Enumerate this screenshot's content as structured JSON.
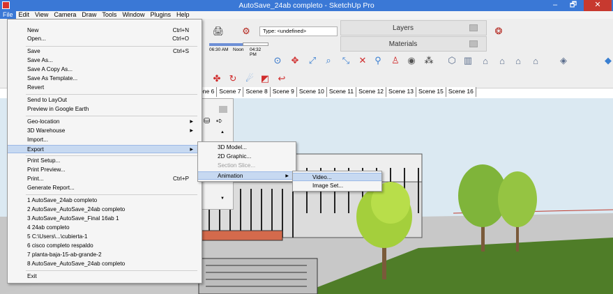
{
  "window": {
    "title": "AutoSave_24ab completo - SketchUp Pro",
    "minimize": "–",
    "maximize": "🗗",
    "close": "✕"
  },
  "menubar": [
    "File",
    "Edit",
    "View",
    "Camera",
    "Draw",
    "Tools",
    "Window",
    "Plugins",
    "Help"
  ],
  "toolbar": {
    "type_field": "Type: <undefined>",
    "time_left": "06:30 AM",
    "time_mid": "Noon",
    "time_right": "04:32 PM"
  },
  "trays": {
    "layers": "Layers",
    "materials": "Materials"
  },
  "scene_tabs": [
    "ene 6",
    "Scene 7",
    "Scene 8",
    "Scene 9",
    "Scene 10",
    "Scene 11",
    "Scene 12",
    "Scene 13",
    "Scene 15",
    "Scene 16"
  ],
  "file_menu": {
    "new": {
      "label": "New",
      "shortcut": "Ctrl+N"
    },
    "open": {
      "label": "Open...",
      "shortcut": "Ctrl+O"
    },
    "save": {
      "label": "Save",
      "shortcut": "Ctrl+S"
    },
    "save_as": {
      "label": "Save As..."
    },
    "save_copy": {
      "label": "Save A Copy As..."
    },
    "save_template": {
      "label": "Save As Template..."
    },
    "revert": {
      "label": "Revert"
    },
    "send_layout": {
      "label": "Send to LayOut"
    },
    "preview_ge": {
      "label": "Preview in Google Earth"
    },
    "geo": {
      "label": "Geo-location"
    },
    "warehouse": {
      "label": "3D Warehouse"
    },
    "import": {
      "label": "Import..."
    },
    "export": {
      "label": "Export"
    },
    "print_setup": {
      "label": "Print Setup..."
    },
    "print_preview": {
      "label": "Print Preview..."
    },
    "print": {
      "label": "Print...",
      "shortcut": "Ctrl+P"
    },
    "report": {
      "label": "Generate Report..."
    },
    "recent": [
      "1 AutoSave_24ab completo",
      "2 AutoSave_AutoSave_24ab completo",
      "3 AutoSave_AutoSave_Final 16ab 1",
      "4 24ab completo",
      "5 C:\\Users\\...\\cubierta-1",
      "6 cisco completo respaldo",
      "7 planta-baja-15-ab-grande-2",
      "8 AutoSave_AutoSave_24ab completo"
    ],
    "exit": {
      "label": "Exit"
    }
  },
  "export_menu": {
    "model3d": "3D Model...",
    "graphic2d": "2D Graphic...",
    "section": "Section Slice...",
    "animation": "Animation"
  },
  "animation_menu": {
    "video": "Video...",
    "image_set": "Image Set..."
  },
  "colors": {
    "titlebar": "#3a78d6",
    "highlight": "#c7d9f1",
    "close": "#c7392f"
  }
}
